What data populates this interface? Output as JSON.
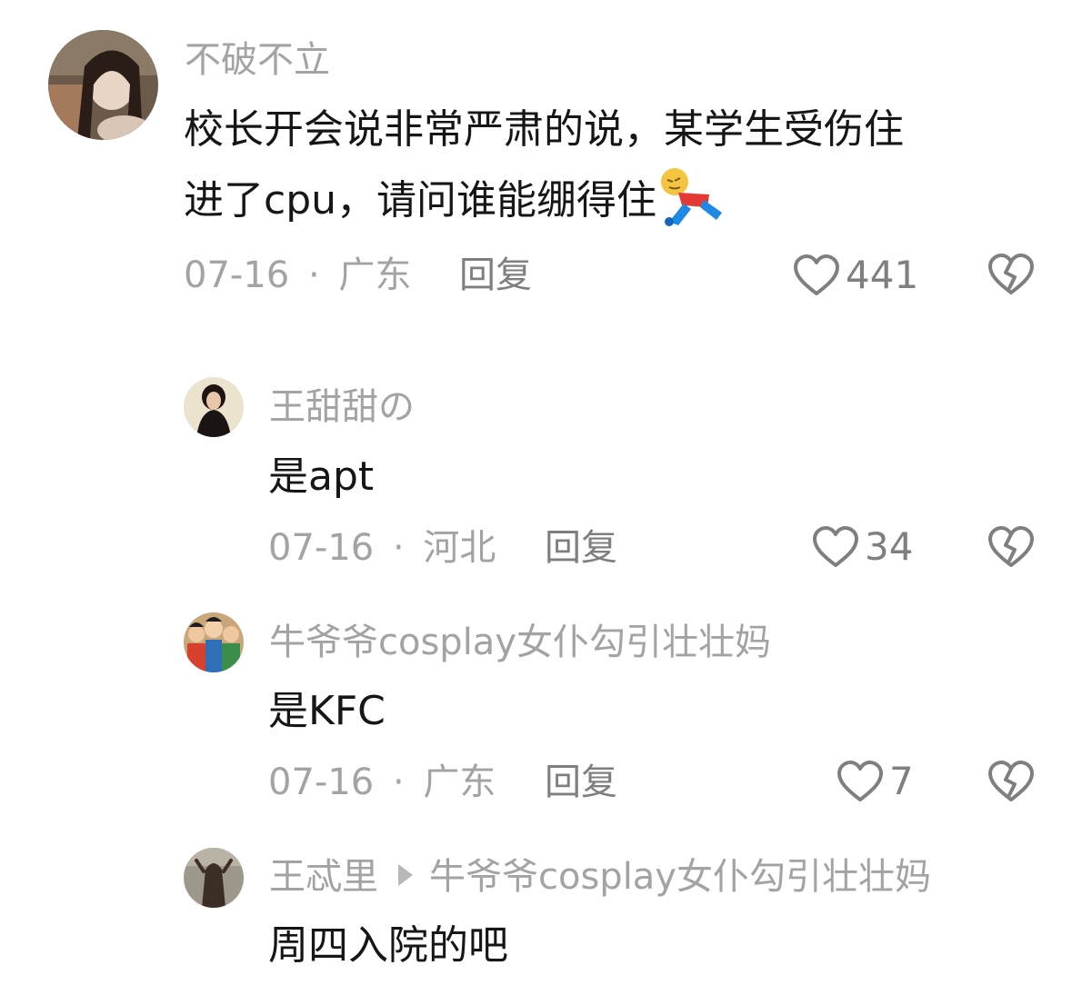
{
  "comments": [
    {
      "username": "不破不立",
      "line1": "校长开会说非常严肃的说，某学生受伤住",
      "line2": "进了cpu，请问谁能绷得住",
      "emoji": "person-falling-emoji",
      "date": "07-16",
      "location": "广东",
      "separator": "·",
      "reply": "回复",
      "likes": "441"
    }
  ],
  "replies": [
    {
      "username": "王甜甜の",
      "text": "是apt",
      "date": "07-16",
      "location": "河北",
      "separator": "·",
      "reply": "回复",
      "likes": "34"
    },
    {
      "username": "牛爷爷cosplay女仆勾引壮壮妈",
      "text": "是KFC",
      "date": "07-16",
      "location": "广东",
      "separator": "·",
      "reply": "回复",
      "likes": "7"
    },
    {
      "username": "王忒里",
      "reply_to": "牛爷爷cosplay女仆勾引壮壮妈",
      "text": "周四入院的吧"
    }
  ],
  "icons": {
    "like": "heart-outline-icon",
    "dislike": "broken-heart-icon",
    "reply_to": "triangle-right-icon"
  },
  "colors": {
    "text_primary": "#161616",
    "text_secondary": "#a3a3a3",
    "action_gray": "#7f7f7f"
  }
}
